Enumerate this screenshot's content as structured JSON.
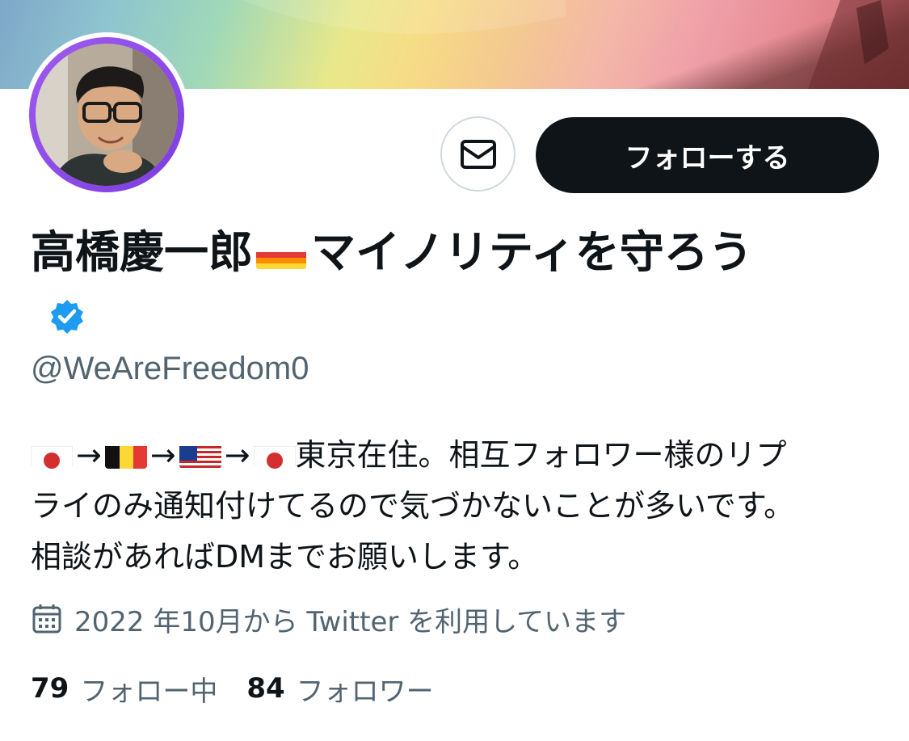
{
  "profile": {
    "display_name_part1": "高橋慶一郎",
    "display_name_part2": "マイノリティを守ろう",
    "handle": "@WeAreFreedom0",
    "verified_icon": "verified-badge-icon",
    "bio": {
      "flags": [
        "japan-flag",
        "belgium-flag",
        "usa-flag",
        "japan-flag"
      ],
      "arrow": "→",
      "text_line1": "東京在住。相互フォロワー様のリプ",
      "text_line2": "ライのみ通知付けてるので気づかないことが多いです。",
      "text_line3": "相談があればDMまでお願いします。"
    },
    "joined_text": "2022 年10月から Twitter を利用しています",
    "following_count": "79",
    "following_label": "フォロー中",
    "followers_count": "84",
    "followers_label": "フォロワー"
  },
  "actions": {
    "follow_label": "フォローする",
    "message_icon": "envelope-icon"
  },
  "colors": {
    "primary_text": "#0f1419",
    "secondary_text": "#536471",
    "follow_button_bg": "#0f1419",
    "verified_blue": "#1d9bf0",
    "avatar_ring": "#8b47e8"
  }
}
